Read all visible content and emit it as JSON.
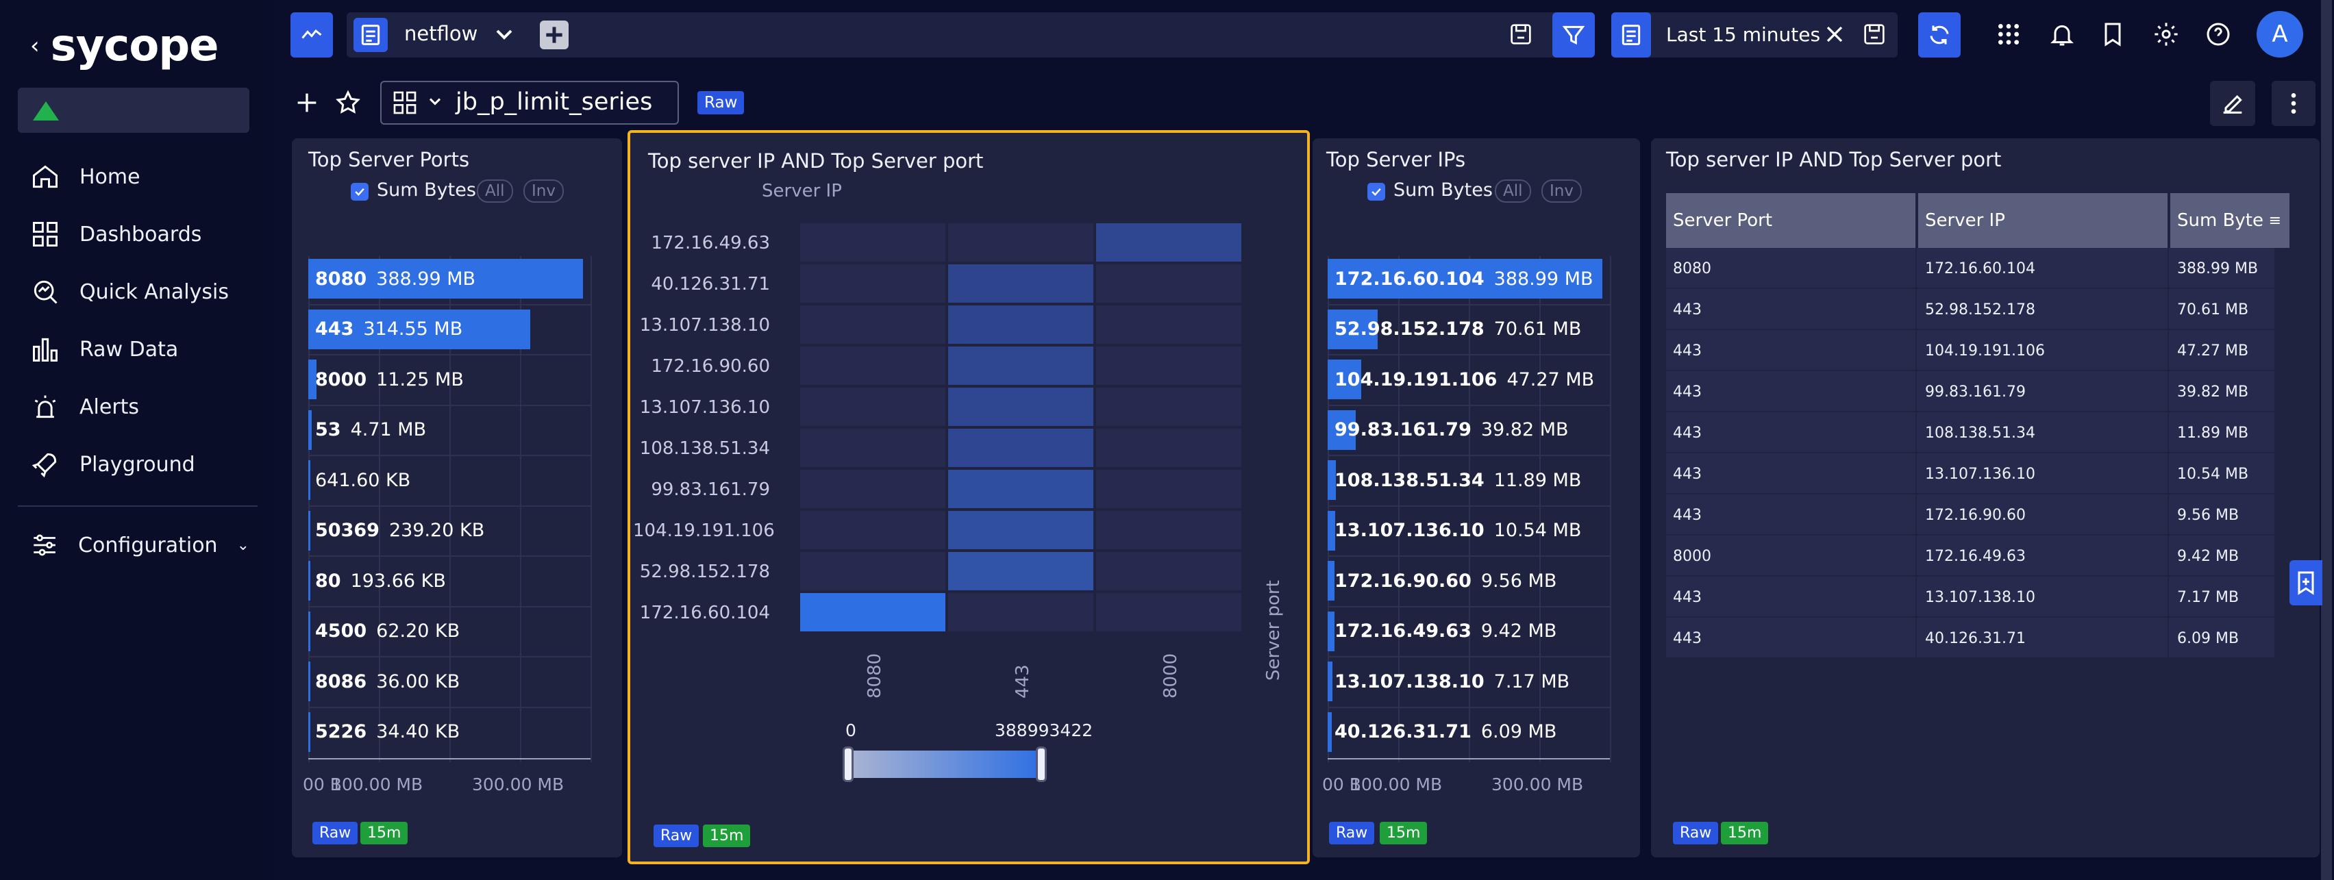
{
  "sidebar": {
    "brand": "sycope",
    "items": [
      {
        "label": "Home",
        "icon": "home-icon"
      },
      {
        "label": "Dashboards",
        "icon": "dashboards-icon"
      },
      {
        "label": "Quick Analysis",
        "icon": "quick-analysis-icon"
      },
      {
        "label": "Raw Data",
        "icon": "raw-data-icon"
      },
      {
        "label": "Alerts",
        "icon": "alerts-icon"
      },
      {
        "label": "Playground",
        "icon": "playground-icon"
      }
    ],
    "config_label": "Configuration"
  },
  "topbar": {
    "source": "netflow",
    "time_range": "Last 15 minutes"
  },
  "dashboard": {
    "name": "jb_p_limit_series",
    "badge": "Raw",
    "user_initial": "A"
  },
  "colors": {
    "accent": "#2f5ce6",
    "selected_border": "#f5b324",
    "success": "#1f9f3a"
  },
  "panels": {
    "ports": {
      "title": "Top Server Ports",
      "checkbox_label": "Sum Bytes",
      "pill_all": "All",
      "pill_inv": "Inv",
      "axis_ticks": [
        "00 B",
        "100.00 MB",
        "300.00 MB"
      ],
      "badge_raw": "Raw",
      "badge_time": "15m"
    },
    "heatmap": {
      "title": "Top server IP AND Top Server port",
      "y_label": "Server IP",
      "x_label": "Server port",
      "scale_min": "0",
      "scale_max": "388993422",
      "badge_raw": "Raw",
      "badge_time": "15m"
    },
    "ips": {
      "title": "Top Server IPs",
      "checkbox_label": "Sum Bytes",
      "pill_all": "All",
      "pill_inv": "Inv",
      "axis_ticks": [
        "00 B",
        "100.00 MB",
        "300.00 MB"
      ],
      "badge_raw": "Raw",
      "badge_time": "15m"
    },
    "table": {
      "title": "Top server IP AND Top Server port",
      "columns": [
        "Server Port",
        "Server IP",
        "Sum Byte"
      ],
      "rows": [
        [
          "8080",
          "172.16.60.104",
          "388.99 MB"
        ],
        [
          "443",
          "52.98.152.178",
          "70.61 MB"
        ],
        [
          "443",
          "104.19.191.106",
          "47.27 MB"
        ],
        [
          "443",
          "99.83.161.79",
          "39.82 MB"
        ],
        [
          "443",
          "108.138.51.34",
          "11.89 MB"
        ],
        [
          "443",
          "13.107.136.10",
          "10.54 MB"
        ],
        [
          "443",
          "172.16.90.60",
          "9.56 MB"
        ],
        [
          "8000",
          "172.16.49.63",
          "9.42 MB"
        ],
        [
          "443",
          "13.107.138.10",
          "7.17 MB"
        ],
        [
          "443",
          "40.126.31.71",
          "6.09 MB"
        ]
      ],
      "badge_raw": "Raw",
      "badge_time": "15m"
    }
  },
  "chart_data": [
    {
      "type": "bar",
      "title": "Top Server Ports",
      "categories": [
        "8080",
        "443",
        "8000",
        "53",
        "",
        "50369",
        "80",
        "4500",
        "8086",
        "5226"
      ],
      "labels": [
        "388.99 MB",
        "314.55 MB",
        "11.25 MB",
        "4.71 MB",
        "641.60 KB",
        "239.20 KB",
        "193.66 KB",
        "62.20 KB",
        "36.00 KB",
        "34.40 KB"
      ],
      "values": [
        388.99,
        314.55,
        11.25,
        4.71,
        0.6416,
        0.2392,
        0.19366,
        0.0622,
        0.036,
        0.0344
      ],
      "unit": "MB",
      "xlim": [
        0,
        400
      ]
    },
    {
      "type": "heatmap",
      "title": "Top server IP AND Top Server port",
      "y": [
        "172.16.49.63",
        "40.126.31.71",
        "13.107.138.10",
        "172.16.90.60",
        "13.107.136.10",
        "108.138.51.34",
        "99.83.161.79",
        "104.19.191.106",
        "52.98.152.178",
        "172.16.60.104"
      ],
      "x": [
        "8080",
        "443",
        "8000"
      ],
      "values": [
        [
          0,
          0,
          9420000
        ],
        [
          0,
          6090000,
          0
        ],
        [
          0,
          7170000,
          0
        ],
        [
          0,
          9560000,
          0
        ],
        [
          0,
          10540000,
          0
        ],
        [
          0,
          11890000,
          0
        ],
        [
          0,
          39820000,
          0
        ],
        [
          0,
          47270000,
          0
        ],
        [
          0,
          70610000,
          0
        ],
        [
          388993422,
          0,
          0
        ]
      ],
      "scale": [
        0,
        388993422
      ],
      "ylabel": "Server IP",
      "xlabel": "Server port"
    },
    {
      "type": "bar",
      "title": "Top Server IPs",
      "categories": [
        "172.16.60.104",
        "52.98.152.178",
        "104.19.191.106",
        "99.83.161.79",
        "108.138.51.34",
        "13.107.136.10",
        "172.16.90.60",
        "172.16.49.63",
        "13.107.138.10",
        "40.126.31.71"
      ],
      "labels": [
        "388.99 MB",
        "70.61 MB",
        "47.27 MB",
        "39.82 MB",
        "11.89 MB",
        "10.54 MB",
        "9.56 MB",
        "9.42 MB",
        "7.17 MB",
        "6.09 MB"
      ],
      "values": [
        388.99,
        70.61,
        47.27,
        39.82,
        11.89,
        10.54,
        9.56,
        9.42,
        7.17,
        6.09
      ],
      "unit": "MB",
      "xlim": [
        0,
        400
      ]
    }
  ]
}
